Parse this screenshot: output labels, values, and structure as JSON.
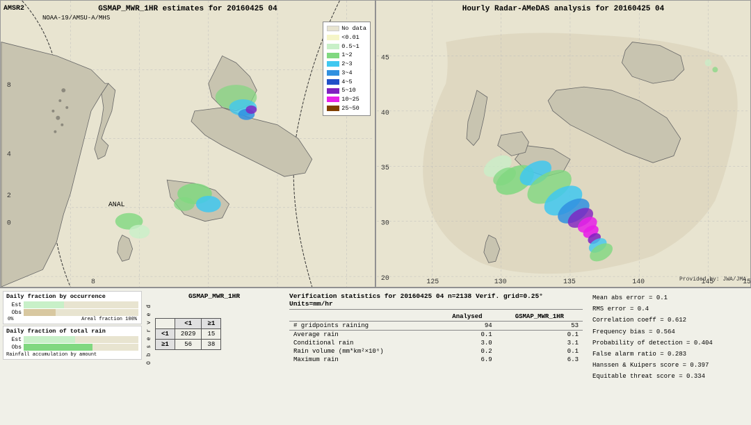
{
  "maps": {
    "left": {
      "title": "GSMAP_MWR_1HR estimates for 20160425 04",
      "label_amsr2": "AMSR2",
      "label_noaa": "NOAA-19/AMSU-A/MHS",
      "label_anal": "ANAL",
      "label_gsmap": "GSMAP_MWR_1HR"
    },
    "right": {
      "title": "Hourly Radar-AMeDAS analysis for 20160425 04",
      "credit": "Provided by: JWA/JMA"
    }
  },
  "legend": {
    "title": "",
    "items": [
      {
        "label": "No data",
        "color": "#e8e4d0"
      },
      {
        "label": "<0.01",
        "color": "#f5f0d0"
      },
      {
        "label": "0.5~1",
        "color": "#c8f0c8"
      },
      {
        "label": "1~2",
        "color": "#80d880"
      },
      {
        "label": "2~3",
        "color": "#40c8f0"
      },
      {
        "label": "3~4",
        "color": "#3090e0"
      },
      {
        "label": "4~5",
        "color": "#2050c8"
      },
      {
        "label": "5~10",
        "color": "#8020c0"
      },
      {
        "label": "10~25",
        "color": "#e820e8"
      },
      {
        "label": "25~50",
        "color": "#804000"
      }
    ]
  },
  "charts": {
    "fraction_by_occurrence": {
      "title": "Daily fraction by occurrence",
      "est_value": 35,
      "obs_value": 28,
      "axis_left": "0%",
      "axis_right": "Areal fraction 100%"
    },
    "fraction_by_rain": {
      "title": "Daily fraction of total rain",
      "est_value": 45,
      "obs_value": 60,
      "axis_note": "Rainfall accumulation by amount"
    }
  },
  "contingency": {
    "title": "GSMAP_MWR_1HR",
    "col_lt1": "<1",
    "col_ge1": "≥1",
    "row_lt1": "<1",
    "row_ge1": "≥1",
    "obs_label": "O\nb\ns\ne\nr\nv\ne\nd",
    "cell_a": "2029",
    "cell_b": "15",
    "cell_c": "56",
    "cell_d": "38"
  },
  "verification": {
    "title": "Verification statistics for 20160425 04  n=2138  Verif. grid=0.25°  Units=mm/hr",
    "headers": [
      "",
      "Analysed",
      "GSMAP_MWR_1HR"
    ],
    "rows": [
      {
        "label": "# gridpoints raining",
        "analysed": "94",
        "gsmap": "53"
      },
      {
        "label": "Average rain",
        "analysed": "0.1",
        "gsmap": "0.1"
      },
      {
        "label": "Conditional rain",
        "analysed": "3.0",
        "gsmap": "3.1"
      },
      {
        "label": "Rain volume (mm*km²×10⁶)",
        "analysed": "0.2",
        "gsmap": "0.1"
      },
      {
        "label": "Maximum rain",
        "analysed": "6.9",
        "gsmap": "6.3"
      }
    ]
  },
  "stats": {
    "mean_abs_error": "Mean abs error = 0.1",
    "rms_error": "RMS error = 0.4",
    "correlation": "Correlation coeff = 0.612",
    "freq_bias": "Frequency bias = 0.564",
    "prob_detection": "Probability of detection = 0.404",
    "false_alarm": "False alarm ratio = 0.283",
    "hanssen_kuipers": "Hanssen & Kuipers score = 0.397",
    "equitable_threat": "Equitable threat score = 0.334"
  }
}
